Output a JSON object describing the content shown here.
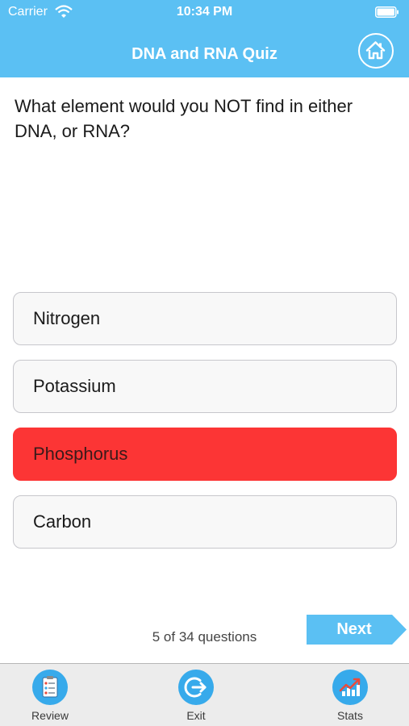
{
  "status_bar": {
    "carrier": "Carrier",
    "time": "10:34 PM"
  },
  "header": {
    "title": "DNA and RNA Quiz",
    "home_icon": "home-icon"
  },
  "question": "What element would you NOT find in either DNA, or RNA?",
  "answers": [
    {
      "label": "Nitrogen",
      "state": "default"
    },
    {
      "label": "Potassium",
      "state": "default"
    },
    {
      "label": "Phosphorus",
      "state": "wrong"
    },
    {
      "label": "Carbon",
      "state": "default"
    }
  ],
  "progress_text": "5 of 34 questions",
  "next_label": "Next",
  "tabs": [
    {
      "label": "Review",
      "icon": "clipboard-icon"
    },
    {
      "label": "Exit",
      "icon": "exit-icon"
    },
    {
      "label": "Stats",
      "icon": "chart-icon"
    }
  ],
  "colors": {
    "header": "#5bc0f3",
    "wrong_answer": "#fc3535",
    "tab_icon": "#37aaeb",
    "next_button": "#5bc0f3"
  }
}
